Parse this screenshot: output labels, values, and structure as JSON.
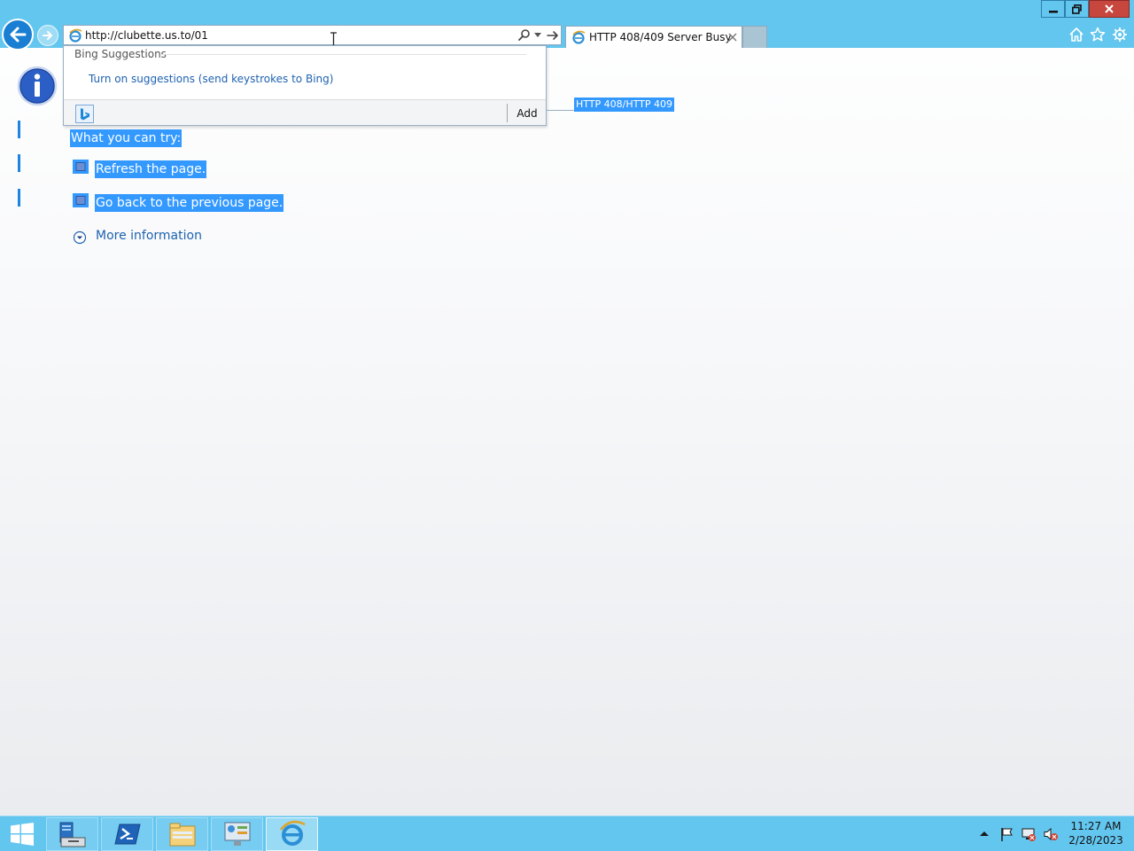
{
  "browser": {
    "address_value": "http://clubette.us.to/01",
    "tab_title": "HTTP 408/409 Server Busy"
  },
  "suggestions": {
    "header": "Bing Suggestions",
    "turn_on_link": "Turn on suggestions (send keystrokes to Bing)",
    "add_button": "Add"
  },
  "page": {
    "error_code": "HTTP 408/HTTP 409",
    "try_heading": "What you can try:",
    "actions": [
      "Refresh the page.",
      "Go back to the previous page."
    ],
    "more_info": "More information"
  },
  "taskbar": {
    "time": "11:27 AM",
    "date": "2/28/2023"
  },
  "colors": {
    "chrome": "#63c6ef",
    "selection": "#3399ff",
    "link": "#1e62b0"
  },
  "icons": [
    "back-arrow-icon",
    "forward-arrow-icon",
    "ie-icon",
    "search-icon",
    "go-arrow-icon",
    "close-icon",
    "home-icon",
    "favorites-star-icon",
    "settings-gear-icon",
    "info-icon",
    "bing-icon",
    "windows-logo-icon",
    "server-manager-icon",
    "powershell-icon",
    "file-explorer-icon",
    "control-panel-icon",
    "internet-explorer-icon",
    "flag-icon",
    "network-icon",
    "speaker-muted-icon"
  ]
}
